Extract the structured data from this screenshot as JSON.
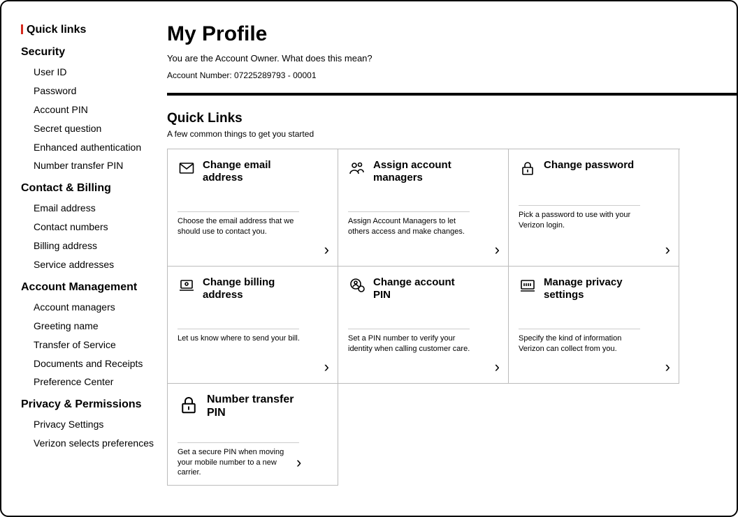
{
  "sidebar": {
    "title": "Quick links",
    "sections": [
      {
        "heading": "Security",
        "items": [
          "User ID",
          "Password",
          "Account PIN",
          "Secret question",
          "Enhanced authentication",
          "Number transfer PIN"
        ]
      },
      {
        "heading": "Contact & Billing",
        "items": [
          "Email address",
          "Contact numbers",
          "Billing address",
          "Service addresses"
        ]
      },
      {
        "heading": "Account Management",
        "items": [
          "Account managers",
          "Greeting name",
          "Transfer of Service",
          "Documents and Receipts",
          "Preference Center"
        ]
      },
      {
        "heading": "Privacy & Permissions",
        "items": [
          "Privacy Settings",
          "Verizon selects preferences"
        ]
      }
    ]
  },
  "header": {
    "title": "My Profile",
    "owner_prefix": "You are the Account Owner. ",
    "owner_link": "What does this mean?",
    "account_line": "Account Number: 07225289793 - 00001"
  },
  "quicklinks": {
    "title": "Quick Links",
    "subtitle": "A few common things to get you started"
  },
  "cards": [
    {
      "icon": "envelope",
      "title": "Change email address",
      "desc": "Choose the email address that we should use to contact you."
    },
    {
      "icon": "people",
      "title": "Assign account managers",
      "desc": "Assign Account Managers to let others access and make changes."
    },
    {
      "icon": "lock",
      "title": "Change password",
      "desc": "Pick a password to use with your Verizon login."
    },
    {
      "icon": "laptop",
      "title": "Change billing address",
      "desc": "Let us know where to send your bill."
    },
    {
      "icon": "pin-user",
      "title": "Change account PIN",
      "desc": "Set a PIN number to verify your identity when calling customer care."
    },
    {
      "icon": "privacy",
      "title": "Manage privacy settings",
      "desc": "Specify the kind of information Verizon can collect from you."
    },
    {
      "icon": "lock-big",
      "title": "Number transfer PIN",
      "desc": "Get a secure PIN when moving your mobile number to a new carrier."
    }
  ]
}
